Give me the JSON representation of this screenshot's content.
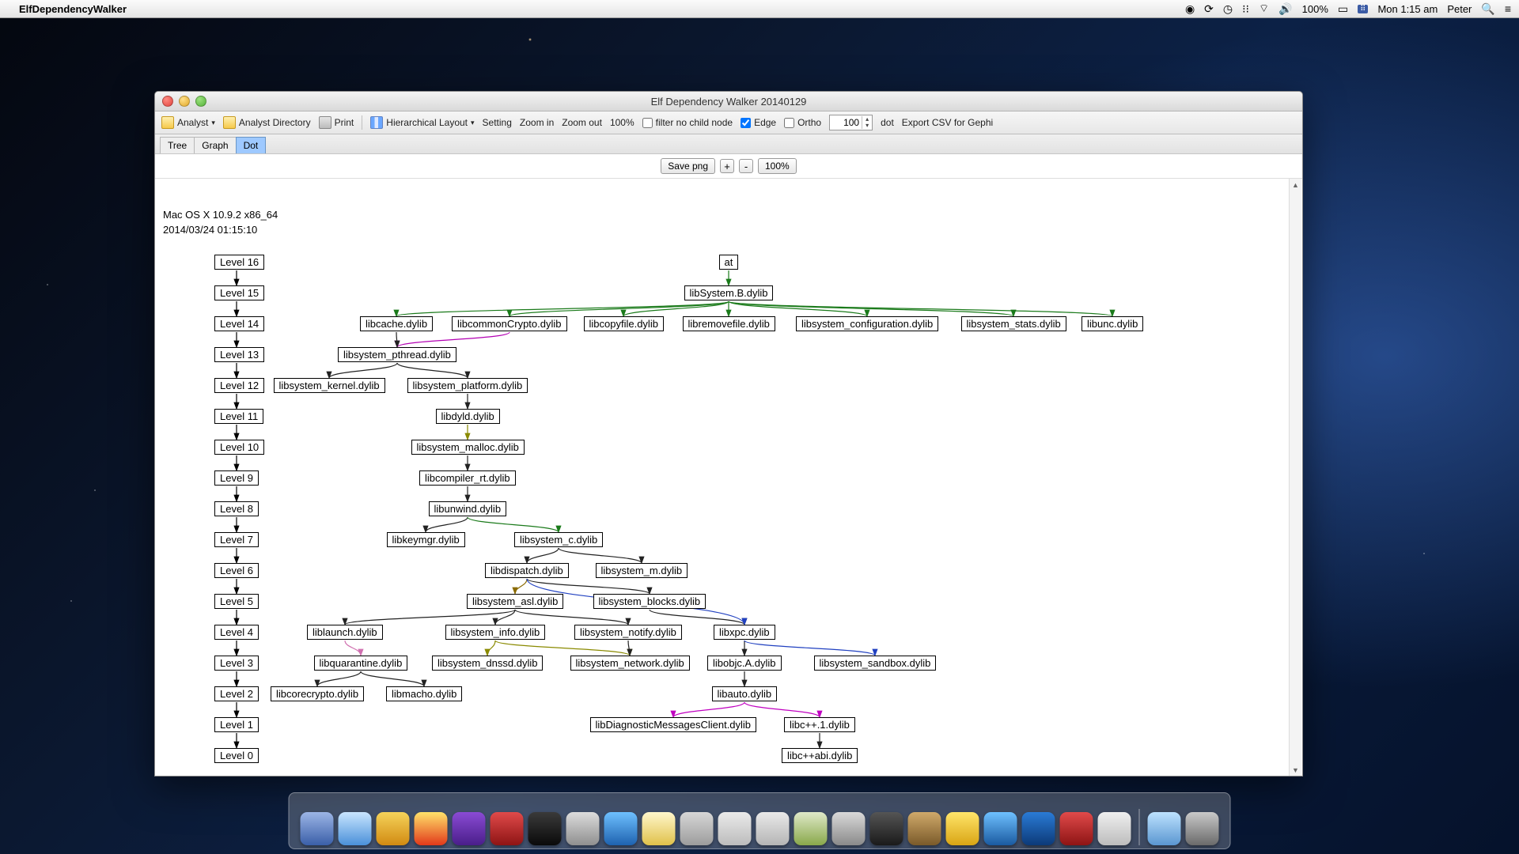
{
  "menubar": {
    "app_name": "ElfDependencyWalker",
    "battery": "100%",
    "clock": "Mon 1:15 am",
    "user": "Peter"
  },
  "window": {
    "title": "Elf Dependency Walker 20140129"
  },
  "toolbar": {
    "analyst": "Analyst",
    "analyst_dir": "Analyst Directory",
    "print": "Print",
    "layout": "Hierarchical Layout",
    "setting": "Setting",
    "zoom_in": "Zoom in",
    "zoom_out": "Zoom out",
    "zoom_100": "100%",
    "filter": "filter no child node",
    "edge": "Edge",
    "ortho": "Ortho",
    "ortho_val": "100",
    "dot": "dot",
    "export": "Export CSV for Gephi"
  },
  "tabs": {
    "tree": "Tree",
    "graph": "Graph",
    "dot": "Dot"
  },
  "viewbar": {
    "save": "Save png",
    "plus": "+",
    "minus": "-",
    "pct": "100%"
  },
  "meta": {
    "os": "Mac OS X 10.9.2 x86_64",
    "ts": "2014/03/24 01:15:10"
  },
  "levels": [
    "Level 16",
    "Level 15",
    "Level 14",
    "Level 13",
    "Level 12",
    "Level 11",
    "Level 10",
    "Level 9",
    "Level 8",
    "Level 7",
    "Level 6",
    "Level 5",
    "Level 4",
    "Level 3",
    "Level 2",
    "Level 1",
    "Level 0"
  ],
  "nodes": {
    "at": "at",
    "sysB": "libSystem.B.dylib",
    "cache": "libcache.dylib",
    "ccrypto": "libcommonCrypto.dylib",
    "copyfile": "libcopyfile.dylib",
    "removefile": "libremovefile.dylib",
    "sysconf": "libsystem_configuration.dylib",
    "sysstats": "libsystem_stats.dylib",
    "unc": "libunc.dylib",
    "pthread": "libsystem_pthread.dylib",
    "kernel": "libsystem_kernel.dylib",
    "platform": "libsystem_platform.dylib",
    "dyld": "libdyld.dylib",
    "malloc": "libsystem_malloc.dylib",
    "compiler": "libcompiler_rt.dylib",
    "unwind": "libunwind.dylib",
    "keymgr": "libkeymgr.dylib",
    "sysc": "libsystem_c.dylib",
    "dispatch": "libdispatch.dylib",
    "sysm": "libsystem_m.dylib",
    "asl": "libsystem_asl.dylib",
    "blocks": "libsystem_blocks.dylib",
    "launch": "liblaunch.dylib",
    "info": "libsystem_info.dylib",
    "notify": "libsystem_notify.dylib",
    "xpc": "libxpc.dylib",
    "quarantine": "libquarantine.dylib",
    "dnssd": "libsystem_dnssd.dylib",
    "network": "libsystem_network.dylib",
    "objc": "libobjc.A.dylib",
    "sandbox": "libsystem_sandbox.dylib",
    "corecrypto": "libcorecrypto.dylib",
    "macho": "libmacho.dylib",
    "auto": "libauto.dylib",
    "diag": "libDiagnosticMessagesClient.dylib",
    "cpp1": "libc++.1.dylib",
    "cppabi": "libc++abi.dylib"
  },
  "dock_colors": [
    "linear-gradient(#9cb5e6,#3a5fa8)",
    "linear-gradient(#c9e5ff,#4a90d9)",
    "linear-gradient(#f5d35a,#d18a12)",
    "linear-gradient(#ffe26a,#e2391a)",
    "linear-gradient(#8a4bd4,#4a1e8a)",
    "linear-gradient(#e04a4a,#8e1414)",
    "linear-gradient(#3a3a3a,#0a0a0a)",
    "linear-gradient(#dcdcdc,#8f8f8f)",
    "linear-gradient(#6ec0ff,#1e62af)",
    "linear-gradient(#fff7cc,#e0c14a)",
    "linear-gradient(#d7d7d7,#9c9c9c)",
    "linear-gradient(#eaeaea,#bcbcbc)",
    "linear-gradient(#e9e9e9,#b5b5b5)",
    "linear-gradient(#dfe9c9,#89a84a)",
    "linear-gradient(#d9d9d9,#8a8a8a)",
    "linear-gradient(#555,#1a1a1a)",
    "linear-gradient(#cfa96a,#7a5a2a)",
    "linear-gradient(#ffe56a,#d9a514)",
    "linear-gradient(#6ec0ff,#1a5aa0)",
    "linear-gradient(#2a7bd6,#0c3a78)",
    "linear-gradient(#e04a4a,#8e1414)",
    "linear-gradient(#efefef,#bcbcbc)",
    "linear-gradient(#bde2ff,#5a96d0)",
    "linear-gradient(#c9c9c9,#6a6a6a)"
  ]
}
